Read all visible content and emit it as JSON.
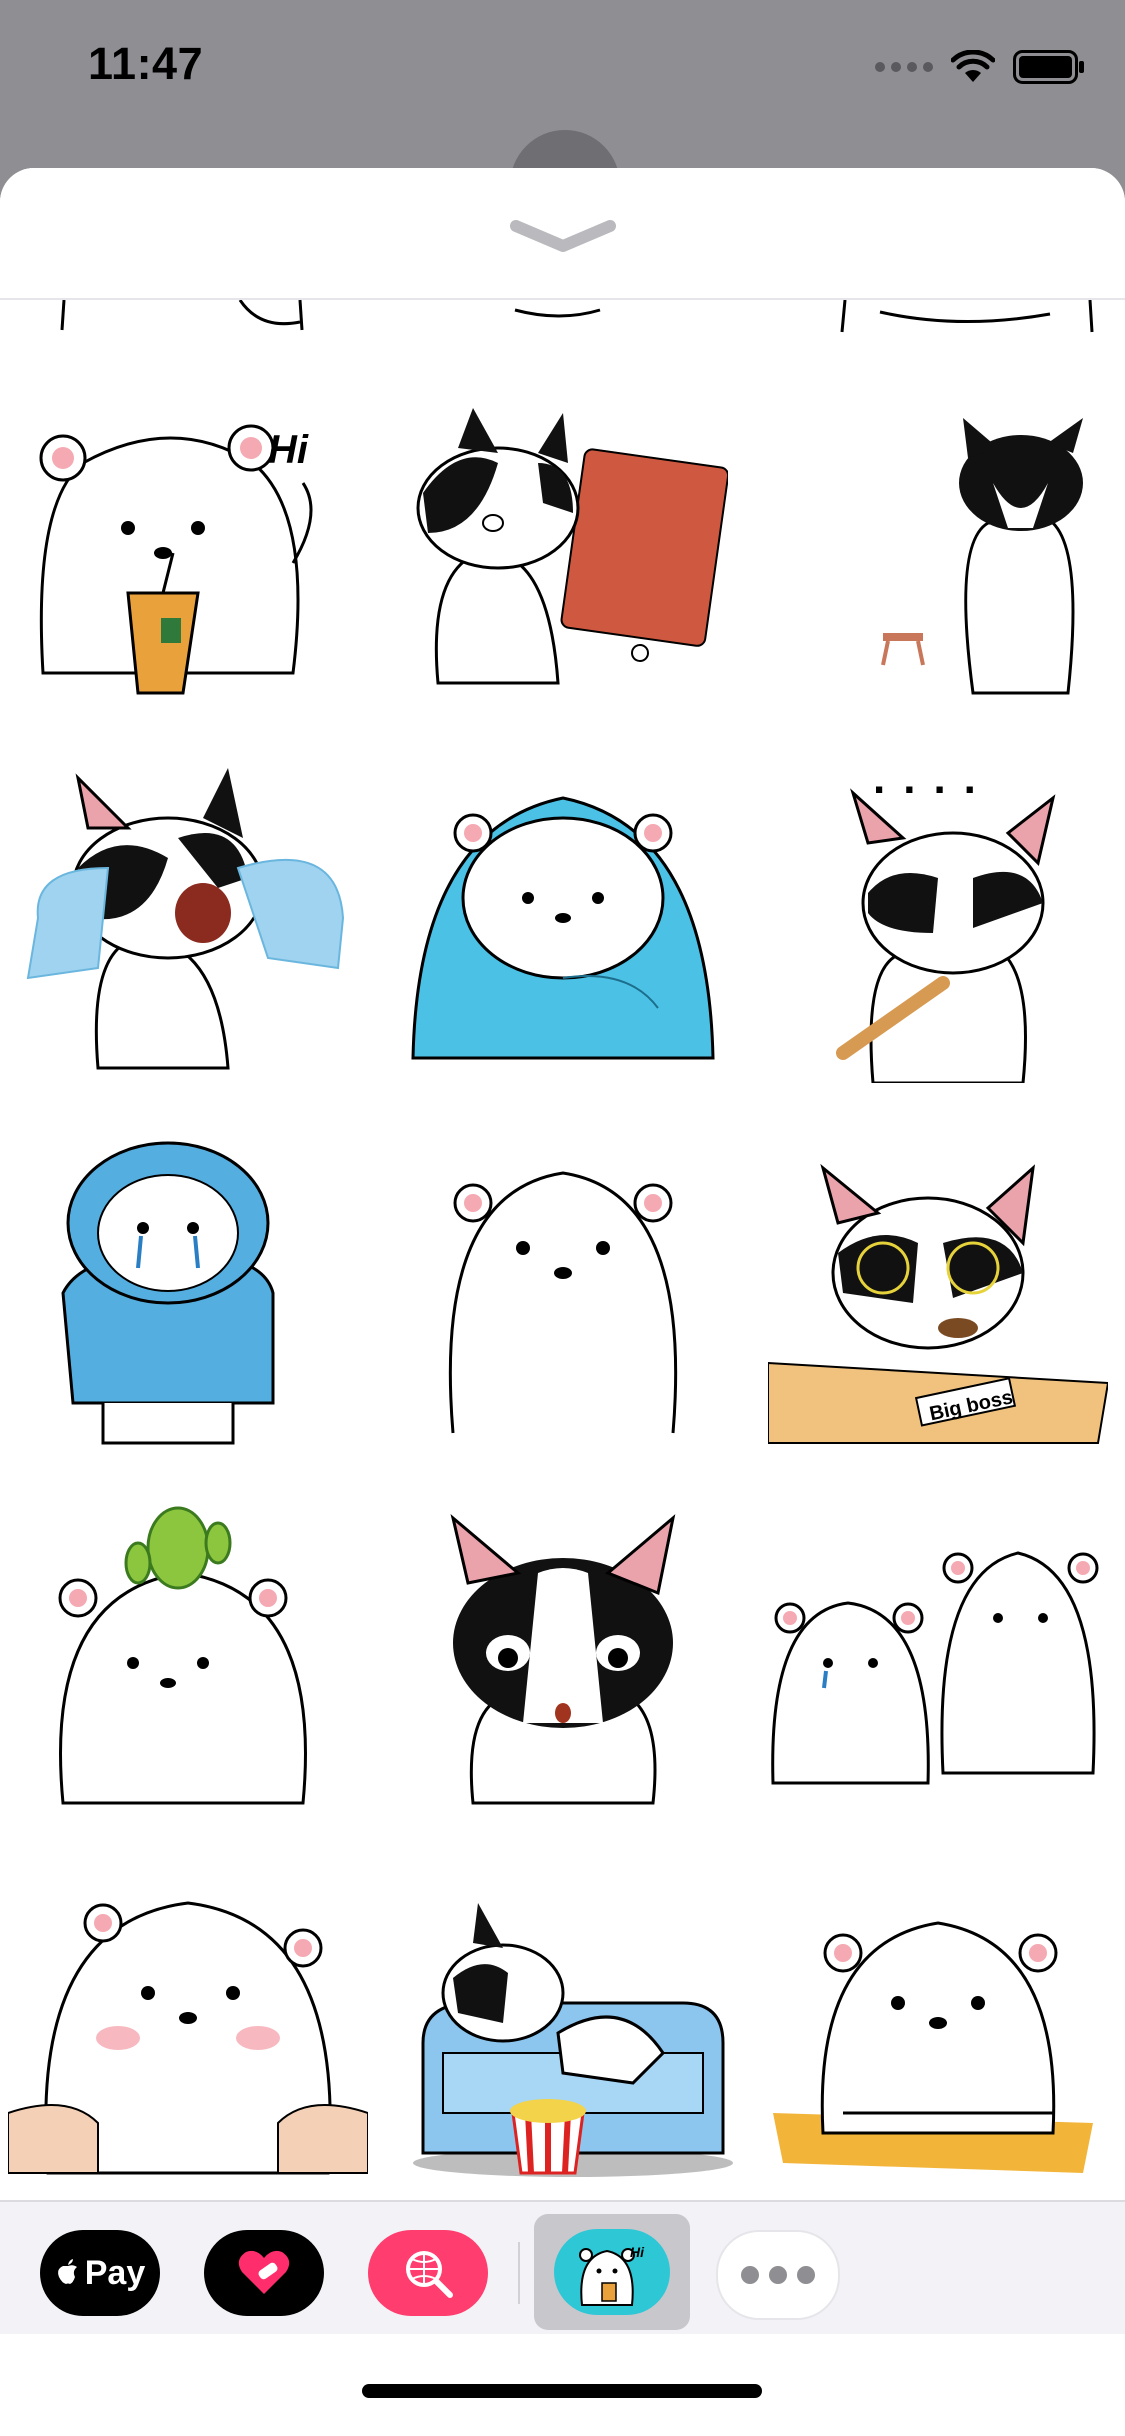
{
  "status_bar": {
    "time": "11:47"
  },
  "sheet": {},
  "grid": {
    "stickers": [
      {
        "name": "bear-hi-drink-sticker",
        "caption": "Hi"
      },
      {
        "name": "dog-red-bag-sticker"
      },
      {
        "name": "dog-back-sticker"
      },
      {
        "name": "dog-crying-sticker"
      },
      {
        "name": "bear-blanket-sticker"
      },
      {
        "name": "dog-angry-bat-sticker",
        "caption": "...."
      },
      {
        "name": "bear-blue-hoodie-sticker"
      },
      {
        "name": "bear-standing-sticker"
      },
      {
        "name": "dog-big-boss-sticker",
        "caption": "Big boss"
      },
      {
        "name": "bear-cactus-sticker"
      },
      {
        "name": "dog-surprised-sticker"
      },
      {
        "name": "two-bears-sticker"
      },
      {
        "name": "bear-cheeks-squeezed-sticker"
      },
      {
        "name": "dog-sofa-popcorn-sticker"
      },
      {
        "name": "bear-table-sticker"
      }
    ]
  },
  "app_drawer": {
    "apple_pay": {
      "label": "Pay"
    },
    "sticker_app_icon_caption": "Hi",
    "colors": {
      "search_app": "#ff3d6e",
      "sticker_app": "#2ec7d6"
    }
  }
}
